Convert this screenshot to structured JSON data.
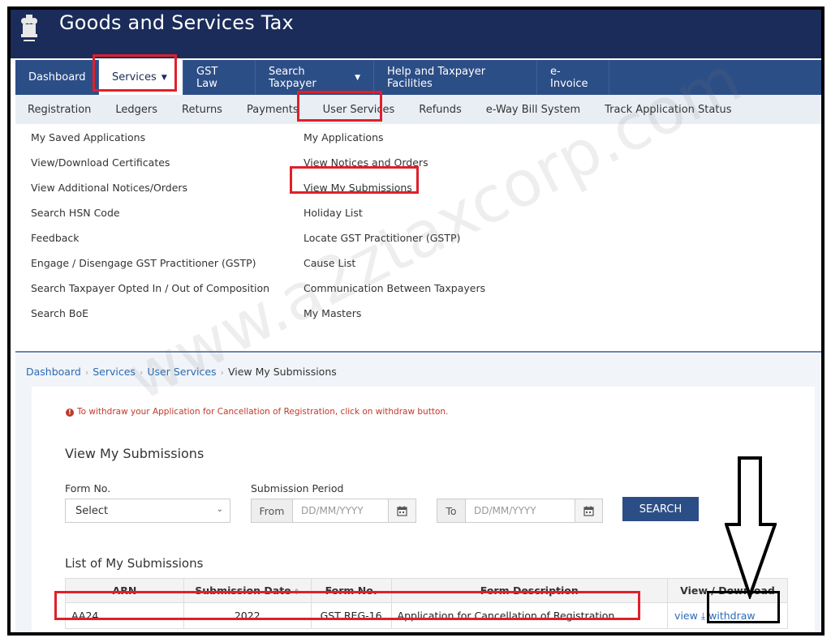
{
  "site": {
    "title": "Goods and Services Tax"
  },
  "main_nav": [
    {
      "label": "Dashboard",
      "caret": false
    },
    {
      "label": "Services",
      "caret": true
    },
    {
      "label": "GST Law",
      "caret": false
    },
    {
      "label": "Search Taxpayer",
      "caret": true
    },
    {
      "label": "Help and Taxpayer Facilities",
      "caret": false
    },
    {
      "label": "e-Invoice",
      "caret": false
    }
  ],
  "sub_nav": [
    "Registration",
    "Ledgers",
    "Returns",
    "Payments",
    "User Services",
    "Refunds",
    "e-Way Bill System",
    "Track Application Status"
  ],
  "menu": {
    "col1": [
      "My Saved Applications",
      "View/Download Certificates",
      "View Additional Notices/Orders",
      "Search HSN Code",
      "Feedback",
      "Engage / Disengage GST Practitioner (GSTP)",
      "Search Taxpayer Opted In / Out of Composition",
      "Search BoE"
    ],
    "col2": [
      "My Applications",
      "View Notices and Orders",
      "View My Submissions",
      "Holiday List",
      "Locate GST Practitioner (GSTP)",
      "Cause List",
      "Communication Between Taxpayers",
      "My Masters"
    ]
  },
  "breadcrumb": [
    "Dashboard",
    "Services",
    "User Services",
    "View My Submissions"
  ],
  "info_message": "To withdraw your Application for Cancellation of Registration, click on withdraw button.",
  "panel_title": "View My Submissions",
  "form": {
    "form_no_label": "Form No.",
    "form_no_value": "Select",
    "period_label": "Submission Period",
    "from_label": "From",
    "to_label": "To",
    "date_placeholder": "DD/MM/YYYY",
    "search_label": "SEARCH"
  },
  "list_title": "List of My Submissions",
  "table": {
    "headers": [
      "ARN",
      "Submission Date",
      "Form No.",
      "Form Description",
      "View / Download"
    ],
    "row": {
      "arn": "AA24",
      "date": "2022",
      "form_no": "GST REG-16",
      "description": "Application for Cancellation of Registration",
      "view": "view",
      "withdraw": "withdraw"
    }
  },
  "watermark": "www.a2ztaxcorp.com",
  "colors": {
    "header": "#1b2b5a",
    "nav": "#2c4e86",
    "highlight": "#e0202a",
    "link": "#2a6bb5",
    "error": "#c0392b"
  }
}
